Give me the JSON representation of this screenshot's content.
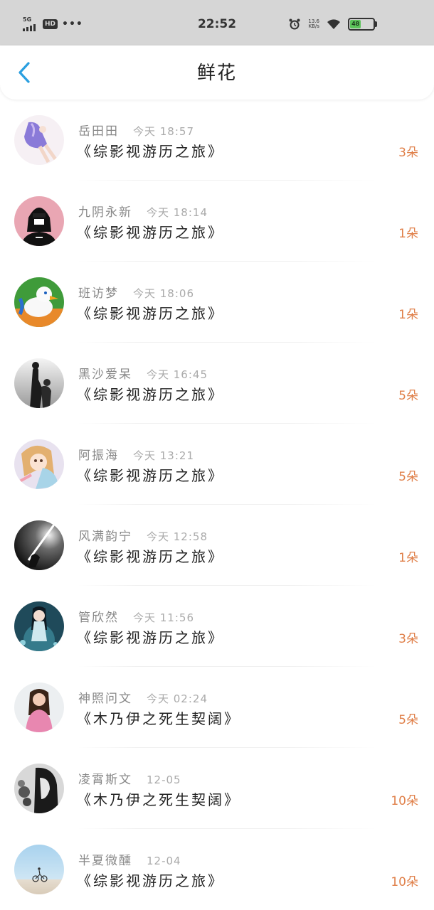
{
  "status_bar": {
    "network": "5G",
    "hd": "HD",
    "dots": "•••",
    "time": "22:52",
    "speed_value": "13.6",
    "speed_unit": "KB/s",
    "battery": "48"
  },
  "header": {
    "title": "鲜花",
    "back_icon": "chevron-left-icon"
  },
  "colors": {
    "accent_blue": "#2a9fe0",
    "count_orange": "#e0804a",
    "status_bar_bg": "#d6d6d6",
    "battery_green": "#5cc45a"
  },
  "gifts": [
    {
      "user": "岳田田",
      "time": "今天 18:57",
      "book": "《综影视游历之旅》",
      "count": "3朵"
    },
    {
      "user": "九阴永新",
      "time": "今天 18:14",
      "book": "《综影视游历之旅》",
      "count": "1朵"
    },
    {
      "user": "班访梦",
      "time": "今天 18:06",
      "book": "《综影视游历之旅》",
      "count": "1朵"
    },
    {
      "user": "黑沙爱呆",
      "time": "今天 16:45",
      "book": "《综影视游历之旅》",
      "count": "5朵"
    },
    {
      "user": "阿振海",
      "time": "今天 13:21",
      "book": "《综影视游历之旅》",
      "count": "5朵"
    },
    {
      "user": "风满韵宁",
      "time": "今天 12:58",
      "book": "《综影视游历之旅》",
      "count": "1朵"
    },
    {
      "user": "管欣然",
      "time": "今天 11:56",
      "book": "《综影视游历之旅》",
      "count": "3朵"
    },
    {
      "user": "神照问文",
      "time": "今天 02:24",
      "book": "《木乃伊之死生契阔》",
      "count": "5朵"
    },
    {
      "user": "凌霄斯文",
      "time": "12-05",
      "book": "《木乃伊之死生契阔》",
      "count": "10朵"
    },
    {
      "user": "半夏微醺",
      "time": "12-04",
      "book": "《综影视游历之旅》",
      "count": "10朵"
    }
  ]
}
